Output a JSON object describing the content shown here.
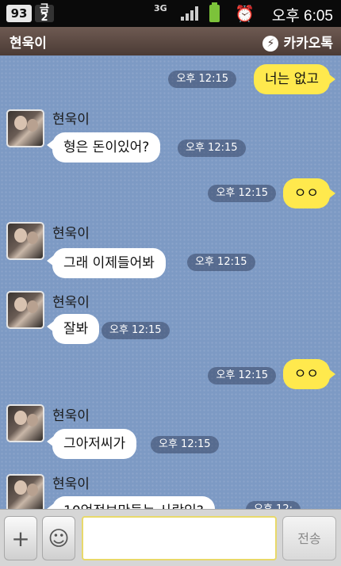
{
  "status_bar": {
    "badge_number": "93",
    "day_badge": "금\n2",
    "network": "3G",
    "clock": "오후 6:05",
    "icons": [
      "signal-icon",
      "battery-icon",
      "alarm-icon"
    ]
  },
  "header": {
    "title": "현욱이",
    "brand": "카카오톡"
  },
  "messages": [
    {
      "from": "me",
      "text": "너는 없고",
      "time": "오후 12:15"
    },
    {
      "from": "현욱이",
      "text": "형은 돈이있어?",
      "time": "오후 12:15"
    },
    {
      "from": "me",
      "text": "ㅇㅇ",
      "time": "오후 12:15"
    },
    {
      "from": "현욱이",
      "text": "그래 이제들어봐",
      "time": "오후 12:15"
    },
    {
      "from": "현욱이",
      "text": "잘봐",
      "time": "오후 12:15"
    },
    {
      "from": "me",
      "text": "ㅇㅇ",
      "time": "오후 12:15"
    },
    {
      "from": "현욱이",
      "text": "그아저씨가",
      "time": "오후 12:15"
    },
    {
      "from": "현욱이",
      "text": "10억정보만들는 사람있?",
      "time": "오후 12:"
    }
  ],
  "input_bar": {
    "input_value": "",
    "send_label": "전송",
    "plus_label": "+",
    "emoji_label": "☺"
  },
  "colors": {
    "chat_background": "#7d9ac4",
    "outgoing_bubble": "#ffe94d",
    "incoming_bubble": "#ffffff",
    "titlebar": "#5a4842"
  }
}
